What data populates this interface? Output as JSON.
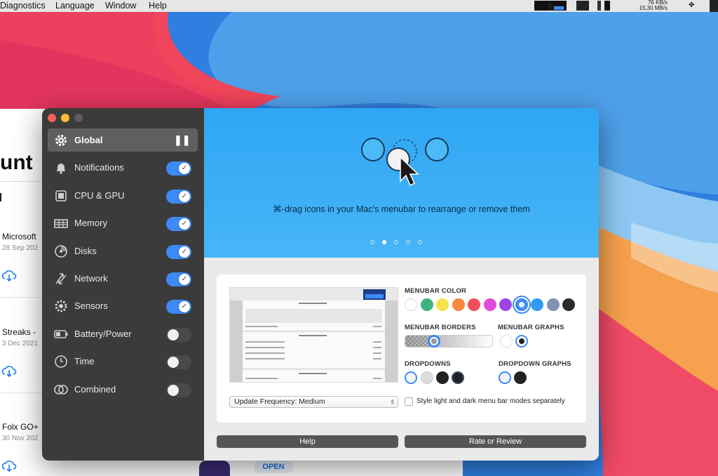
{
  "menubar": {
    "items": [
      "Diagnostics",
      "Language",
      "Window",
      "Help"
    ],
    "net_up": "76 KB/s",
    "net_down": "15,30 MB/s"
  },
  "store": {
    "heading": "unt",
    "apps": [
      {
        "name": "Microsoft",
        "date": "28 Sep 202"
      },
      {
        "name": "Streaks -",
        "date": "3 Dec 2021"
      },
      {
        "name": "Folx GO+",
        "date": "30 Nov 202"
      }
    ],
    "open_label": "OPEN"
  },
  "sidebar": {
    "items": [
      {
        "label": "Global",
        "icon": "gear-icon",
        "state": "pause"
      },
      {
        "label": "Notifications",
        "icon": "bell-icon",
        "state": "on"
      },
      {
        "label": "CPU & GPU",
        "icon": "cpu-icon",
        "state": "on"
      },
      {
        "label": "Memory",
        "icon": "memory-icon",
        "state": "on"
      },
      {
        "label": "Disks",
        "icon": "disk-icon",
        "state": "on"
      },
      {
        "label": "Network",
        "icon": "network-icon",
        "state": "on"
      },
      {
        "label": "Sensors",
        "icon": "sensor-icon",
        "state": "on"
      },
      {
        "label": "Battery/Power",
        "icon": "battery-icon",
        "state": "off"
      },
      {
        "label": "Time",
        "icon": "clock-icon",
        "state": "off"
      },
      {
        "label": "Combined",
        "icon": "combined-icon",
        "state": "off"
      }
    ]
  },
  "banner": {
    "text": "⌘-drag icons in your Mac's menubar to rearrange or remove them",
    "pages": 5,
    "active_page": 2
  },
  "settings": {
    "menubar_color_label": "MENUBAR COLOR",
    "menubar_colors": [
      "#ffffff",
      "#3fb37f",
      "#f4e34a",
      "#f68a3a",
      "#ef4e5a",
      "#e24bd9",
      "#9b45e4",
      "#3d8af7",
      "#2f9bf2",
      "#8191b2",
      "#2b2b2b"
    ],
    "menubar_color_selected": 7,
    "menubar_borders_label": "MENUBAR BORDERS",
    "menubar_graphs_label": "MENUBAR GRAPHS",
    "dropdowns_label": "DROPDOWNS",
    "dropdown_graphs_label": "DROPDOWN GRAPHS",
    "update_frequency": "Update Frequency: Medium",
    "style_checkbox_label": "Style light and dark menu bar modes separately",
    "style_checked": false
  },
  "buttons": {
    "help": "Help",
    "rate": "Rate or Review"
  }
}
